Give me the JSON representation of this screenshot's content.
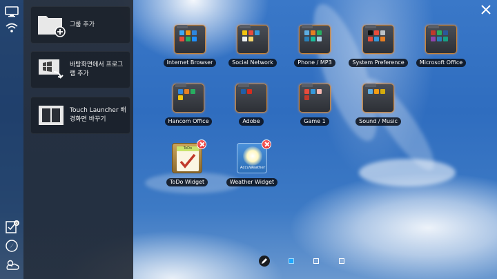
{
  "panel": {
    "items": [
      {
        "label": "그룹 추가",
        "icon": "folder-add-icon"
      },
      {
        "label": "바탕화면에서 프로그램 추가",
        "icon": "windows-import-icon"
      },
      {
        "label": "Touch Launcher 배경화면 바꾸기",
        "icon": "wallpaper-book-icon"
      }
    ]
  },
  "folders": [
    {
      "label": "Internet Browser"
    },
    {
      "label": "Social Network"
    },
    {
      "label": "Phone / MP3"
    },
    {
      "label": "System Preference"
    },
    {
      "label": "Microsoft Office"
    },
    {
      "label": "Hancom Office"
    },
    {
      "label": "Adobe"
    },
    {
      "label": "Game 1"
    },
    {
      "label": "Sound / Music"
    }
  ],
  "widgets": [
    {
      "label": "ToDo Widget",
      "inner_text": "ToDo"
    },
    {
      "label": "Weather Widget",
      "inner_text": "AccuWeather"
    }
  ],
  "pager": {
    "count": 3,
    "active_index": 0
  },
  "colors": {
    "folder_glow": "#c8843a",
    "remove_red": "#d81f1f",
    "page_active": "#1ea7ff"
  }
}
